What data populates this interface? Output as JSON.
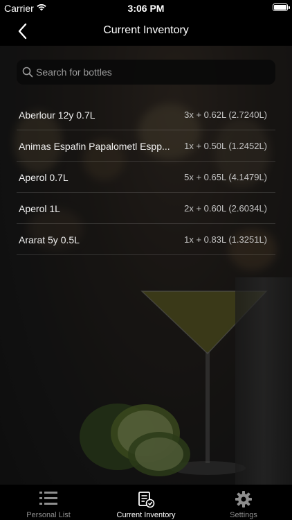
{
  "status_bar": {
    "carrier": "Carrier",
    "time": "3:06 PM"
  },
  "nav": {
    "title": "Current Inventory",
    "back_icon": "chevron-left-icon"
  },
  "search": {
    "placeholder": "Search for bottles",
    "value": ""
  },
  "inventory": [
    {
      "name": "Aberlour 12y 0.7L",
      "quantity": "3x + 0.62L (2.7240L)"
    },
    {
      "name": "Animas Espafin  Papalometl  Espp...",
      "quantity": "1x + 0.50L (1.2452L)"
    },
    {
      "name": "Aperol 0.7L",
      "quantity": "5x + 0.65L (4.1479L)"
    },
    {
      "name": "Aperol 1L",
      "quantity": "2x + 0.60L (2.6034L)"
    },
    {
      "name": "Ararat 5y 0.5L",
      "quantity": "1x + 0.83L (1.3251L)"
    }
  ],
  "tabs": [
    {
      "label": "Personal List",
      "icon": "list-icon",
      "active": false
    },
    {
      "label": "Current Inventory",
      "icon": "clipboard-check-icon",
      "active": true
    },
    {
      "label": "Settings",
      "icon": "gear-icon",
      "active": false
    }
  ]
}
